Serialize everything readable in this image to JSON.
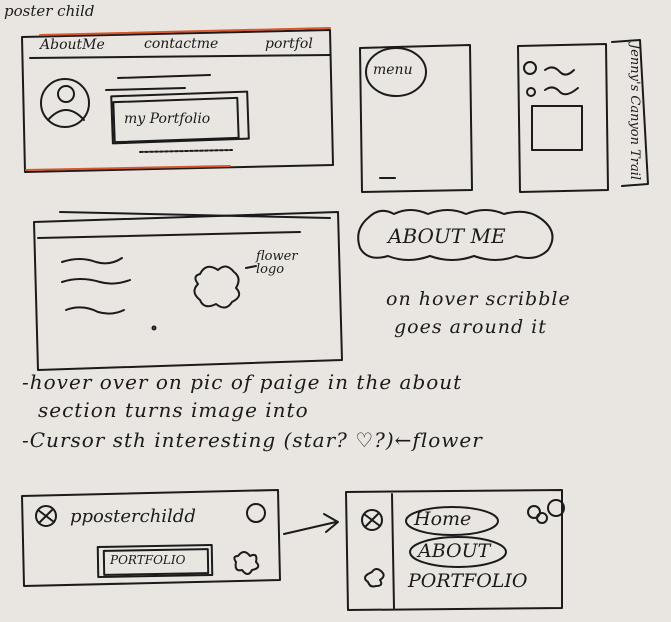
{
  "page_title": "poster child",
  "top_nav": {
    "about": "AboutMe",
    "contact": "contactme",
    "portfolio": "portfol"
  },
  "hero": {
    "button": "my Portfolio"
  },
  "mobile": {
    "menu": "menu"
  },
  "side_note": "Jenny's Canyon Trail",
  "flower_frame": {
    "label": "flower logo"
  },
  "about_bubble": {
    "label": "ABOUT ME",
    "hover_note_1": "on hover scribble",
    "hover_note_2": "goes around it"
  },
  "notes": {
    "line1": "-hover over on pic of paige in the about",
    "line2": "section turns image into",
    "line3": "-Cursor sth interesting (star? ♡?)←flower"
  },
  "bottom_left": {
    "logo": "pposterchildd",
    "button": "PORTFOLIO"
  },
  "bottom_right": {
    "nav": [
      "Home",
      "ABOUT",
      "PORTFOLIO"
    ]
  },
  "colors": {
    "ink": "#1b1b1b",
    "paper": "#e9e6e1",
    "accent": "#d9572c"
  }
}
